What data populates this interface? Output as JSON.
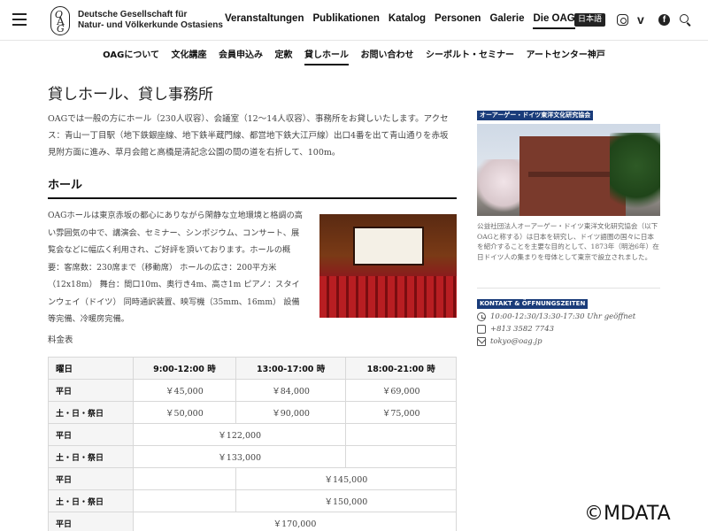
{
  "header": {
    "logo_line1": "Deutsche Gesellschaft für",
    "logo_line2": "Natur- und Völkerkunde Ostasiens",
    "nav": [
      "Veranstaltungen",
      "Publikationen",
      "Katalog",
      "Personen",
      "Galerie",
      "Die OAG"
    ],
    "active_nav": "Die OAG",
    "lang": "日本語"
  },
  "subnav": {
    "items": [
      "OAGについて",
      "文化講座",
      "会員申込み",
      "定款",
      "貸しホール",
      "お問い合わせ",
      "シーボルト・セミナー",
      "アートセンター神戸"
    ],
    "active": "貸しホール"
  },
  "main": {
    "title": "貸しホール、貸し事務所",
    "intro": "OAGでは一般の方にホール（230人収容）、会議室（12～14人収容）、事務所をお貸しいたします。アクセス：青山一丁目駅（地下鉄銀座線、地下鉄半蔵門線、都営地下鉄大江戸線）出口4番を出て青山通りを赤坂見附方面に進み、草月会館と高橋是清記念公園の間の道を右折して、100m。",
    "section_title": "ホール",
    "hall_text": "OAGホールは東京赤坂の都心にありながら閑静な立地環境と格調の高い雰囲気の中で、講演会、セミナー、シンポジウム、コンサート、展覧会などに幅広く利用され、ご好評を頂いております。ホールの概要：客席数：230席まで（移動席） ホールの広さ：200平方米（12x18m） 舞台：間口10m、奥行き4m、高さ1m ピアノ：スタインウェイ（ドイツ） 同時通訳装置、映写機（35mm、16mm） 設備等完備、冷暖房完備。",
    "price_label": "料金表"
  },
  "table": {
    "headers": [
      "曜日",
      "9:00-12:00 時",
      "13:00-17:00 時",
      "18:00-21:00 時"
    ],
    "rows3": [
      {
        "day": "平日",
        "a": "￥45,000",
        "b": "￥84,000",
        "c": "￥69,000"
      },
      {
        "day": "土・日・祭日",
        "a": "￥50,000",
        "b": "￥90,000",
        "c": "￥75,000"
      }
    ],
    "rows_ab": [
      {
        "day": "平日",
        "ab": "￥122,000"
      },
      {
        "day": "土・日・祭日",
        "ab": "￥133,000"
      }
    ],
    "rows_bc": [
      {
        "day": "平日",
        "bc": "￥145,000"
      },
      {
        "day": "土・日・祭日",
        "bc": "￥150,000"
      }
    ],
    "rows_abc": [
      {
        "day": "平日",
        "abc": "￥170,000"
      }
    ]
  },
  "sidebar": {
    "tag1": "オーアーゲー・ドイツ東洋文化研究協会",
    "description": "公益社団法人オーアーゲー・ドイツ東洋文化研究協会（以下OAGと称する）は日本を研究し、ドイツ語圏の国々に日本を紹介することを主要な目的として、1873年（明治6年）在日ドイツ人の集まりを母体として東京で設立されました。",
    "tag2": "KONTAKT & ÖFFNUNGSZEITEN",
    "hours": "10:00-12:30/13:30-17:30 Uhr geöffnet",
    "phone": "+813 3582 7743",
    "email": "tokyo@oag.jp"
  },
  "watermark": "©MDATA"
}
